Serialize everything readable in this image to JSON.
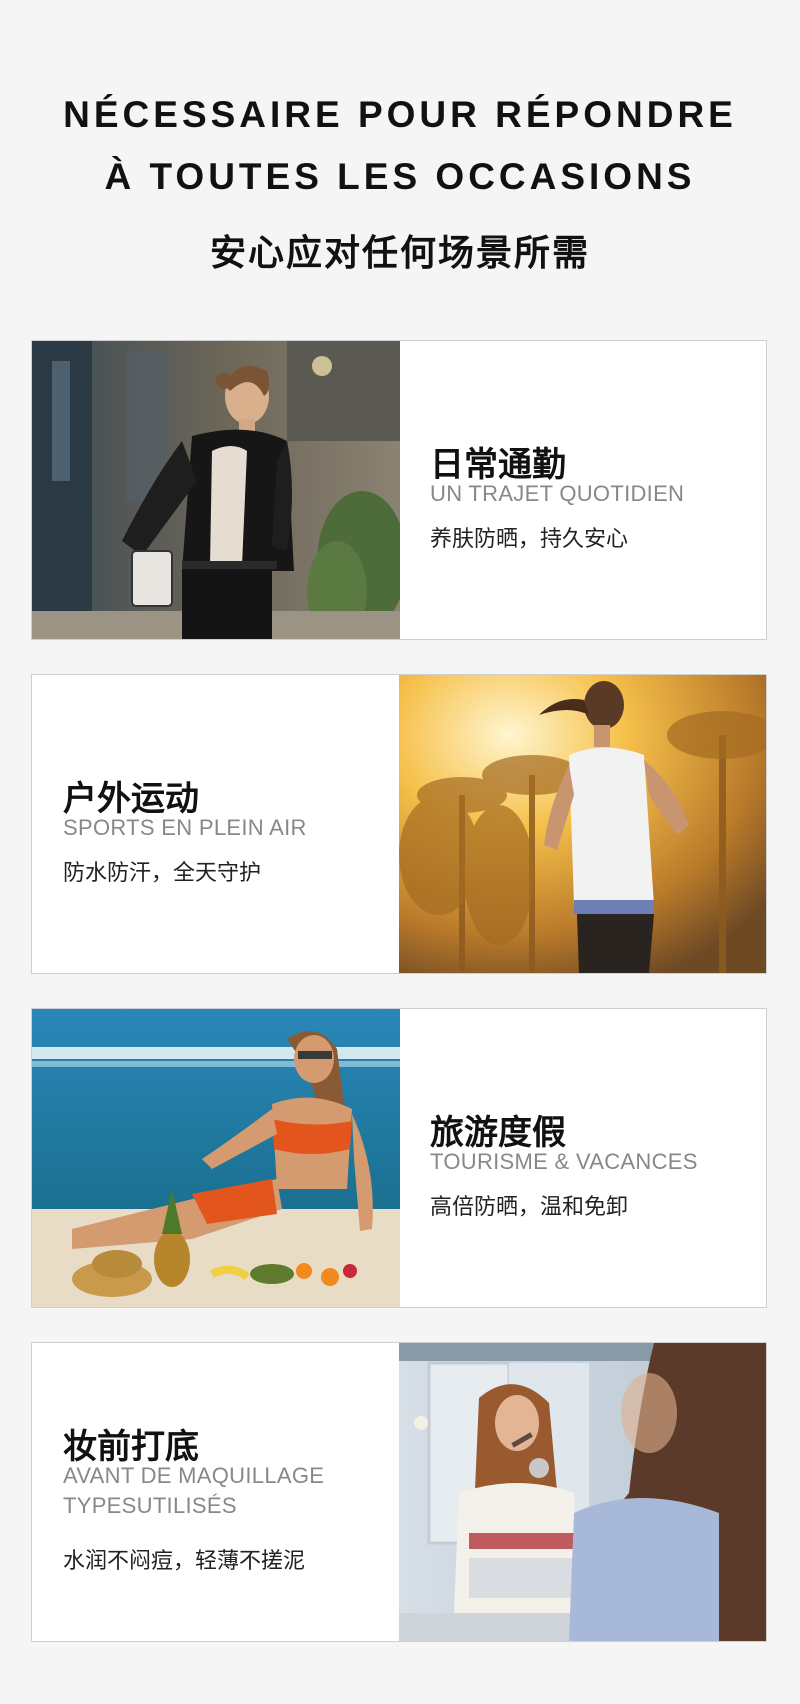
{
  "header": {
    "title_line1": "NÉCESSAIRE POUR RÉPONDRE",
    "title_line2": "À TOUTES LES OCCASIONS",
    "title_zh": "安心应对任何场景所需"
  },
  "cards": [
    {
      "title_zh": "日常通勤",
      "title_fr": "UN TRAJET QUOTIDIEN",
      "desc": "养肤防晒，持久安心",
      "image": "woman-commuting-street-photo"
    },
    {
      "title_zh": "户外运动",
      "title_fr": "SPORTS EN PLEIN AIR",
      "desc": "防水防汗，全天守护",
      "image": "woman-running-sunset-palms-photo"
    },
    {
      "title_zh": "旅游度假",
      "title_fr": "TOURISME & VACANCES",
      "desc": "高倍防晒，温和免卸",
      "image": "woman-bikini-beach-photo"
    },
    {
      "title_zh": "妆前打底",
      "title_fr_line1": "AVANT DE MAQUILLAGE",
      "title_fr_line2": "TYPESUTILISÉS",
      "desc": "水润不闷痘，轻薄不搓泥",
      "image": "woman-makeup-mirror-photo"
    }
  ],
  "colors": {
    "background": "#f5f5f5",
    "card_background": "#ffffff",
    "subtitle_gray": "#888888",
    "title_black": "#111111"
  }
}
